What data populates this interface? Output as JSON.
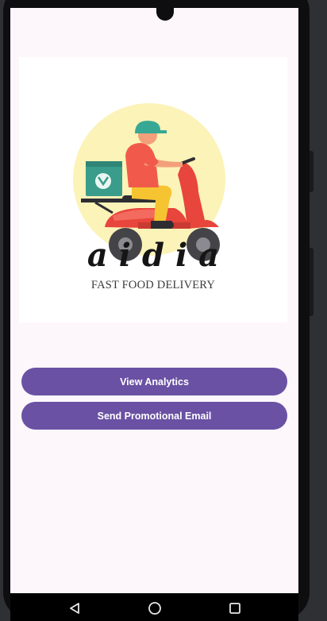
{
  "logo": {
    "brand_name": "aidia",
    "tagline": "FAST FOOD DELIVERY",
    "colors": {
      "circle": "#fbf3b8",
      "helmet": "#38a894",
      "shirt": "#f15a4a",
      "pants": "#f6c431",
      "box": "#3a9c8a",
      "scooter": "#e8453c",
      "wheel": "#444448"
    }
  },
  "actions": {
    "view_analytics": "View Analytics",
    "send_promotional_email": "Send Promotional Email"
  },
  "theme": {
    "button_color": "#6a51a3",
    "screen_background": "#fdf7fc"
  },
  "navigation": {
    "back_icon": "back-triangle-icon",
    "home_icon": "home-circle-icon",
    "recents_icon": "recents-square-icon"
  }
}
